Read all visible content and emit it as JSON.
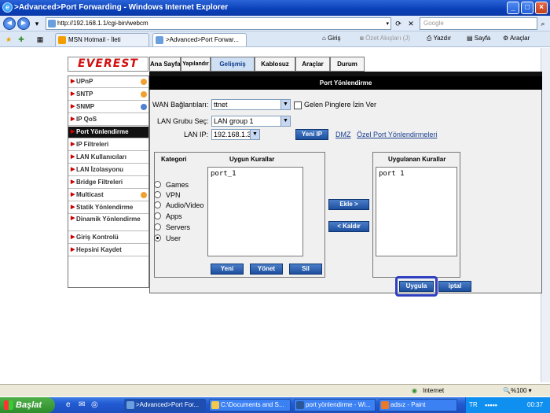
{
  "window": {
    "title": ">Advanced>Port Forwarding - Windows Internet Explorer",
    "url": "http://192.168.1.1/cgi-bin/webcm",
    "search_placeholder": "Google"
  },
  "tabs": [
    {
      "label": "MSN Hotmail - İleti"
    },
    {
      "label": ">Advanced>Port Forwar..."
    }
  ],
  "commandbar": {
    "home": "Giriş",
    "feeds": "Özet Akışları (J)",
    "print": "Yazdır",
    "page": "Sayfa",
    "tools": "Araçlar"
  },
  "router": {
    "logo": "EVEREST",
    "topnav": [
      "Ana Sayfa",
      "Yapılandır",
      "Gelişmiş",
      "Kablosuz",
      "Araçlar",
      "Durum"
    ],
    "sidemenu": [
      "UPnP",
      "SNTP",
      "SNMP",
      "IP QoS",
      "Port Yönlendirme",
      "IP Filtreleri",
      "LAN Kullanıcıları",
      "LAN İzolasyonu",
      "Bridge Filtreleri",
      "Multicast",
      "Statik Yönlendirme",
      "Dinamik Yönlendirme",
      "Giriş Kontrolü",
      "Hepsini Kaydet"
    ],
    "panel_title": "Port Yönlendirme",
    "wan_label": "WAN Bağlantıları:",
    "wan_value": "ttnet",
    "ping_label": "Gelen Pinglere İzin Ver",
    "lan_group_label": "LAN Grubu Seç:",
    "lan_group_value": "LAN group 1",
    "lan_ip_label": "LAN IP:",
    "lan_ip_value": "192.168.1.3",
    "new_ip_button": "Yeni IP",
    "dmz_link": "DMZ",
    "custom_link": "Özel Port Yönlendirmeleri",
    "category_header": "Kategori",
    "categories": [
      "Games",
      "VPN",
      "Audio/Video",
      "Apps",
      "Servers",
      "User"
    ],
    "selected_category": "User",
    "available_header": "Uygun Kurallar",
    "available_rules": [
      "port_1"
    ],
    "applied_header": "Uygulanan Kurallar",
    "applied_rules": [
      "port 1"
    ],
    "add_button": "Ekle >",
    "remove_button": "< Kaldır",
    "new_button": "Yeni",
    "manage_button": "Yönet",
    "delete_button": "Sil",
    "apply_button": "Uygula",
    "cancel_button": "iptal"
  },
  "statusbar": {
    "zone": "Internet",
    "zoom": "%100"
  },
  "taskbar": {
    "start": "Başlat",
    "tasks": [
      ">Advanced>Port For...",
      "C:\\Documents and S...",
      "port yönlendirme - Wi...",
      "adsız - Paint"
    ],
    "lang": "TR",
    "clock": "00:37"
  },
  "colors": {
    "title_blue": "#0a3fb7",
    "logo_red": "#d21010",
    "button_blue": "#1d4f9f",
    "highlight_ring": "#2f3fbf"
  }
}
